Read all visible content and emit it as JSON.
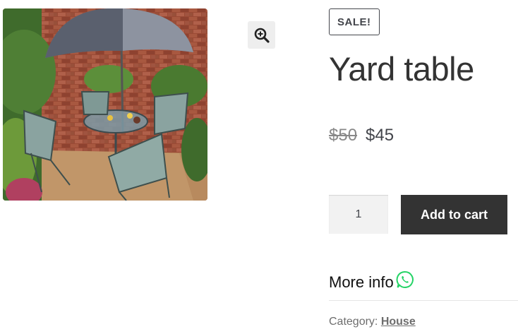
{
  "product": {
    "sale_badge": "SALE!",
    "title": "Yard table",
    "price_old": "$50",
    "price_new": "$45",
    "quantity": "1",
    "add_to_cart_label": "Add to cart",
    "more_info_label": "More info",
    "category_label": "Category:",
    "category_value": "House"
  },
  "icons": {
    "zoom": "magnifier-plus-icon",
    "whatsapp": "whatsapp-icon"
  },
  "colors": {
    "button_bg": "#333333",
    "whatsapp_green": "#25d366",
    "text": "#43454b"
  }
}
